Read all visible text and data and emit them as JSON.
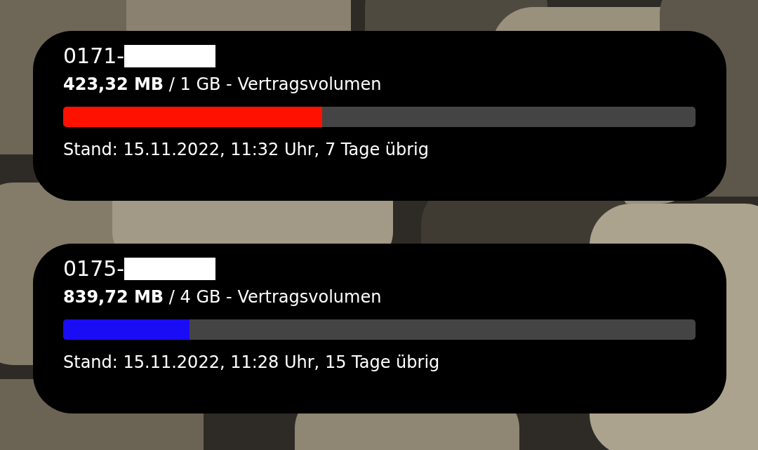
{
  "kind": "picture",
  "widgets": [
    {
      "number": "0171-",
      "redacted": true,
      "usage": "**423,32 MB** / 1 GB - Vertragsvolumen",
      "level": 0.41,
      "color": "#ff1100",
      "status": "Stand: 15.11.2022, 11:32 Uhr, 7 Tage übrig"
    },
    {
      "number": "0175-",
      "redacted": true,
      "usage": "**839,72 MB** / 4 GB - Vertragsvolumen",
      "level": 0.2,
      "color": "#1a0cf5",
      "status": "Stand: 15.11.2022, 11:28 Uhr, 15 Tage übrig"
    }
  ]
}
